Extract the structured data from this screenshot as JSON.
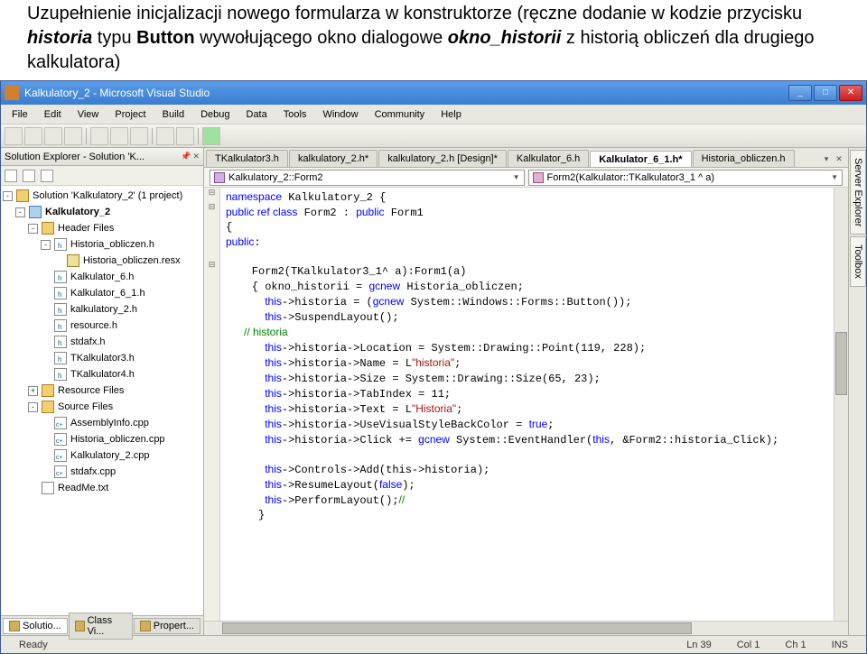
{
  "header_html": "Uzupełnienie inicjalizacji nowego formularza w konstruktorze (ręczne dodanie w kodzie przycisku <b><i>historia</i></b> typu <b>Button</b> wywołującego okno dialogowe <b><i>okno_historii</i></b> z historią obliczeń dla drugiego kalkulatora)",
  "title": "Kalkulatory_2 - Microsoft Visual Studio",
  "menu": [
    "File",
    "Edit",
    "View",
    "Project",
    "Build",
    "Debug",
    "Data",
    "Tools",
    "Window",
    "Community",
    "Help"
  ],
  "solution_panel_title": "Solution Explorer - Solution 'K...",
  "tree": {
    "solution": "Solution 'Kalkulatory_2' (1 project)",
    "project": "Kalkulatory_2",
    "folders": {
      "header": "Header Files",
      "resource": "Resource Files",
      "source": "Source Files"
    },
    "header_items": [
      "Historia_obliczen.h",
      "Historia_obliczen.resx",
      "Kalkulator_6.h",
      "Kalkulator_6_1.h",
      "kalkulatory_2.h",
      "resource.h",
      "stdafx.h",
      "TKalkulator3.h",
      "TKalkulator4.h"
    ],
    "source_items": [
      "AssemblyInfo.cpp",
      "Historia_obliczen.cpp",
      "Kalkulatory_2.cpp",
      "stdafx.cpp"
    ],
    "readme": "ReadMe.txt"
  },
  "tabs": [
    "TKalkulator3.h",
    "kalkulatory_2.h*",
    "kalkulatory_2.h [Design]*",
    "Kalkulator_6.h",
    "Kalkulator_6_1.h*",
    "Historia_obliczen.h"
  ],
  "active_tab_index": 4,
  "combo_left": "Kalkulatory_2::Form2",
  "combo_right": "Form2(Kalkulator::TKalkulator3_1 ^ a)",
  "code_lines": [
    {
      "t": "namespace Kalkulatory_2 {",
      "c": "kw0"
    },
    {
      "t": "public ref class Form2 : public Form1",
      "c": "kw1"
    },
    {
      "t": "{",
      "c": "p"
    },
    {
      "t": "public:",
      "c": "kw2"
    },
    {
      "t": "",
      "c": "p"
    },
    {
      "t": "    Form2(TKalkulator3_1^ a):Form1(a)",
      "c": "p"
    },
    {
      "t": "    { okno_historii = gcnew Historia_obliczen;",
      "c": "kw3"
    },
    {
      "t": "      this->historia = (gcnew System::Windows::Forms::Button());",
      "c": "kw4"
    },
    {
      "t": "      this->SuspendLayout();",
      "c": "kw5"
    },
    {
      "t": "      // historia",
      "c": "cm"
    },
    {
      "t": "      this->historia->Location = System::Drawing::Point(119, 228);",
      "c": "kw5"
    },
    {
      "t": "      this->historia->Name = L\"historia\";",
      "c": "str1"
    },
    {
      "t": "      this->historia->Size = System::Drawing::Size(65, 23);",
      "c": "kw5"
    },
    {
      "t": "      this->historia->TabIndex = 11;",
      "c": "kw5"
    },
    {
      "t": "      this->historia->Text = L\"Historia\";",
      "c": "str2"
    },
    {
      "t": "      this->historia->UseVisualStyleBackColor = true;",
      "c": "kw6"
    },
    {
      "t": "      this->historia->Click += gcnew System::EventHandler(this, &Form2::historia_Click);",
      "c": "kw7"
    },
    {
      "t": "",
      "c": "p"
    },
    {
      "t": "      this->Controls->Add(this->historia);",
      "c": "kw5"
    },
    {
      "t": "      this->ResumeLayout(false);",
      "c": "kw8"
    },
    {
      "t": "      this->PerformLayout();//",
      "c": "kw9"
    },
    {
      "t": "     }",
      "c": "p"
    }
  ],
  "right_tabs": [
    "Server Explorer",
    "Toolbox"
  ],
  "bottom_tabs": [
    "Solutio...",
    "Class Vi...",
    "Propert..."
  ],
  "status": {
    "ready": "Ready",
    "ln": "Ln 39",
    "col": "Col 1",
    "ch": "Ch 1",
    "ins": "INS"
  }
}
